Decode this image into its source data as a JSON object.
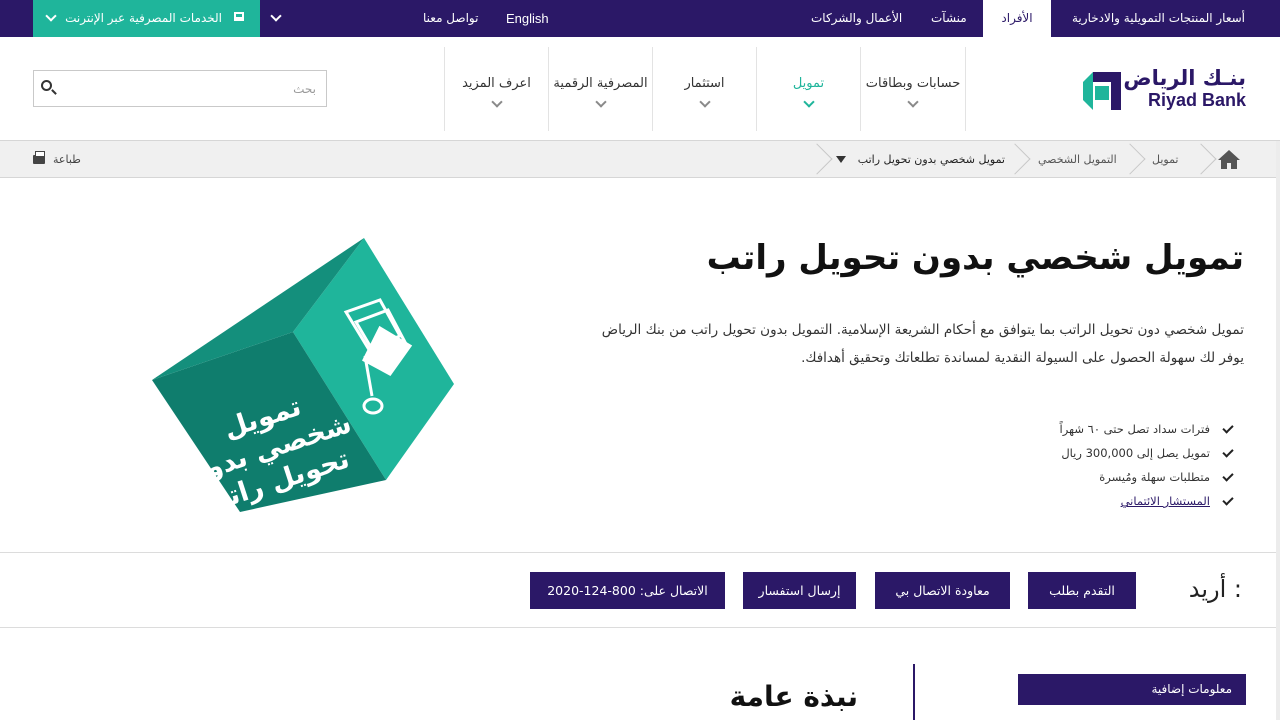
{
  "topbar": {
    "online_banking": "الخدمات المصرفية عبر الإنترنت",
    "contact": "تواصل معنا",
    "language": "English",
    "business": "الأعمال والشركات",
    "enterprises": "منشآت",
    "individuals": "الأفراد",
    "rates": "أسعار المنتجات التمويلية والادخارية"
  },
  "header": {
    "search_placeholder": "بحث",
    "logo_ar": "بنـك الرياض",
    "logo_en": "Riyad Bank",
    "nav": [
      {
        "label": "حسابات وبطاقات"
      },
      {
        "label": "تمويل"
      },
      {
        "label": "استثمار"
      },
      {
        "label": "المصرفية الرقمية"
      },
      {
        "label": "اعرف المزيد"
      }
    ]
  },
  "breadcrumb": {
    "items": [
      "تمويل",
      "التمويل الشخصي"
    ],
    "current": "تمويل شخصي بدون تحويل راتب",
    "print": "طباعة"
  },
  "hero": {
    "title": "تمويل شخصي بدون تحويل راتب",
    "description": "تمويل شخصي دون تحويل الراتب بما يتوافق مع أحكام الشريعة الإسلامية. التمويل بدون تحويل راتب من بنك الرياض يوفر لك سهولة الحصول على السيولة النقدية لمساندة تطلعاتك وتحقيق أهدافك.",
    "features": [
      "فترات سداد تصل حتى ٦٠ شهراً",
      "تمويل يصل إلى 300,000 ريال",
      "متطلبات سهلة ومُيسرة"
    ],
    "advisor_link": "المستشار الائتماني",
    "cube_text": [
      "تمويل",
      "شخصي بدون",
      "تحويل راتب"
    ]
  },
  "actions": {
    "want_label": "أريد :",
    "apply": "التقدم بطلب",
    "callback": "معاودة الاتصال بي",
    "inquiry": "إرسال استفسار",
    "call": "الاتصال على: 800-124-2020"
  },
  "bottom": {
    "additional_info": "معلومات إضافية",
    "overview": "نبذة عامة"
  },
  "colors": {
    "primary": "#2b1867",
    "accent": "#1fb59b"
  }
}
